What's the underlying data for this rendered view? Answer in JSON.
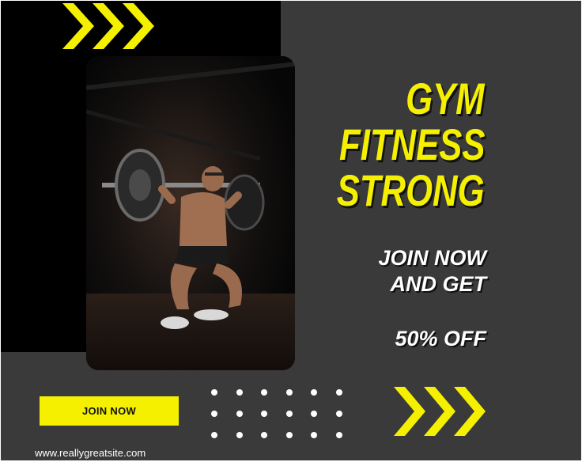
{
  "poster": {
    "headline": [
      "GYM",
      "FITNESS",
      "STRONG"
    ],
    "offer": [
      "JOIN NOW",
      "AND GET",
      "50% OFF"
    ],
    "button_label": "JOIN NOW",
    "website": "www.reallygreatsite.com"
  },
  "colors": {
    "accent": "#f5f000",
    "background": "#3a3a3a",
    "panel": "#000000",
    "text": "#ffffff"
  },
  "icons": [
    "chevrons-right-icon",
    "chevrons-right-icon",
    "dot-grid-icon"
  ]
}
